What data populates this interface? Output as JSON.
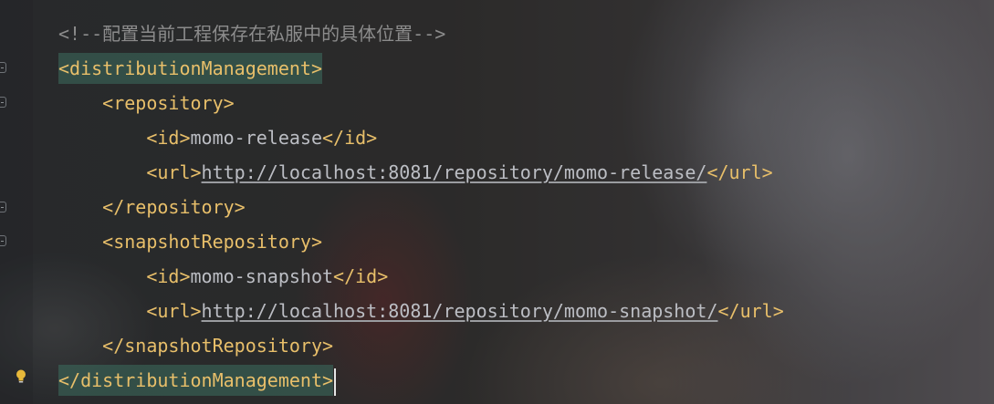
{
  "editor": {
    "language": "xml",
    "lines": [
      {
        "comment": "<!--配置当前工程保存在私服中的具体位置-->"
      },
      {
        "open_tag": "<distributionManagement>"
      },
      {
        "open_tag": "<repository>"
      },
      {
        "open_tag": "<id>",
        "value": "momo-release",
        "close_tag": "</id>"
      },
      {
        "open_tag": "<url>",
        "value": "http://localhost:8081/repository/momo-release/",
        "close_tag": "</url>"
      },
      {
        "close_tag": "</repository>"
      },
      {
        "open_tag": "<snapshotRepository>"
      },
      {
        "open_tag": "<id>",
        "value": "momo-snapshot",
        "close_tag": "</id>"
      },
      {
        "open_tag": "<url>",
        "value": "http://localhost:8081/repository/momo-snapshot/",
        "close_tag": "</url>"
      },
      {
        "close_tag": "</snapshotRepository>"
      },
      {
        "close_tag": "</distributionManagement>"
      }
    ]
  },
  "colors": {
    "tag": "#e8bf6a",
    "comment": "#8c8c8c",
    "text": "#bcbec4",
    "matched_tag_highlight": "#3c6e5f"
  },
  "gutter": {
    "icons": [
      "fold-icon",
      "fold-icon",
      "fold-icon",
      "fold-icon",
      "lightbulb-icon"
    ]
  }
}
